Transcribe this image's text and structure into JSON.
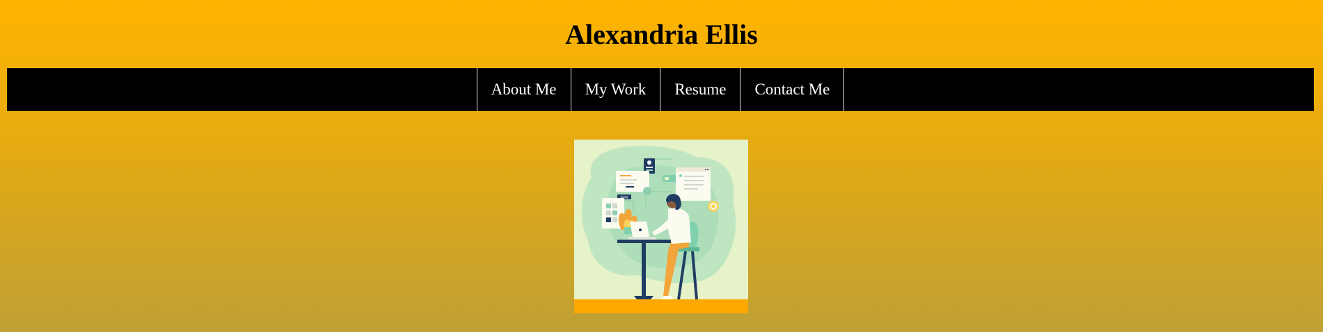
{
  "header": {
    "title": "Alexandria Ellis"
  },
  "nav": {
    "items": [
      {
        "label": "About Me"
      },
      {
        "label": "My Work"
      },
      {
        "label": "Resume"
      },
      {
        "label": "Contact Me"
      }
    ]
  },
  "hero": {
    "image_tag": "www"
  },
  "colors": {
    "background_top": "#ffb400",
    "background_bottom": "#bfa035",
    "nav_background": "#000000",
    "nav_text": "#ffffff",
    "nav_divider": "#e8e8e8",
    "image_footer_bar": "#ffa800",
    "image_background": "#e6f2c8",
    "image_blob": "#b8e3c0"
  },
  "icons": {
    "hero_illustration": "woman-working-on-laptop-illustration"
  }
}
